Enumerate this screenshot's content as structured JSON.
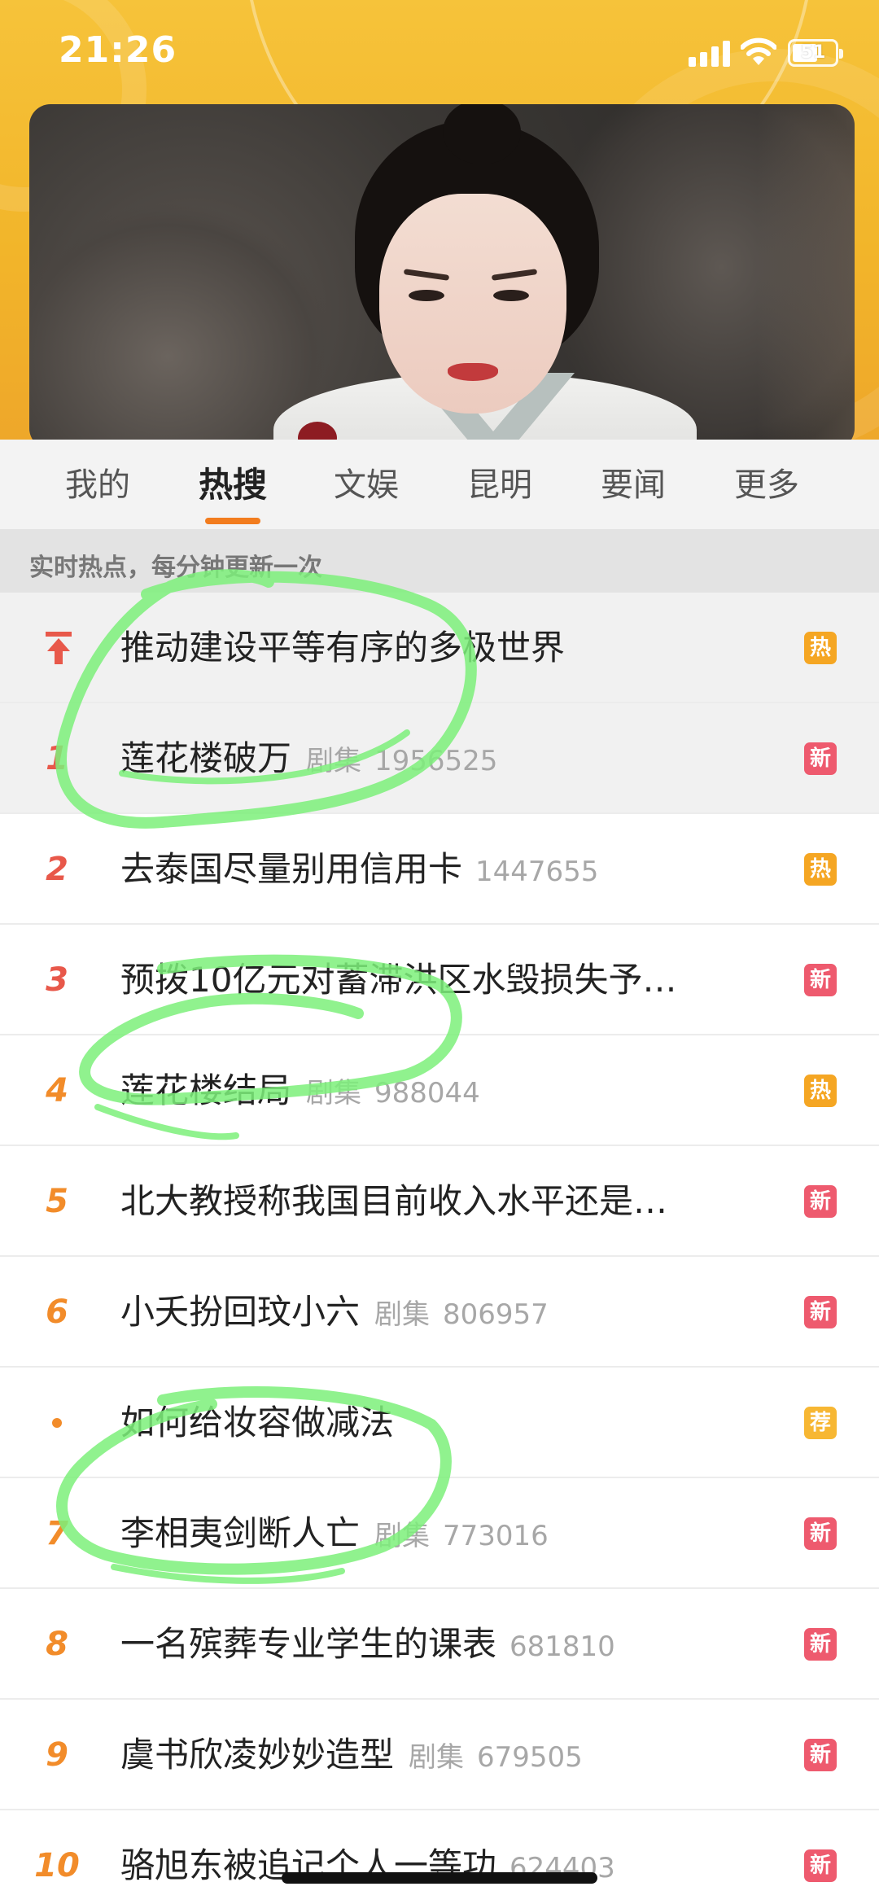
{
  "status_bar": {
    "time": "21:26",
    "battery": "51"
  },
  "tabs": [
    {
      "label": "我的"
    },
    {
      "label": "热搜"
    },
    {
      "label": "文娱"
    },
    {
      "label": "昆明"
    },
    {
      "label": "要闻"
    },
    {
      "label": "更多"
    }
  ],
  "active_tab": "热搜",
  "subtitle": "实时热点，每分钟更新一次",
  "colors": {
    "accent": "#f27c1e",
    "badge_hot": "#f5a623",
    "badge_new": "#ee5a6e",
    "badge_rec": "#f7b733",
    "marker": "#7cf07a"
  },
  "list": [
    {
      "rank": "",
      "rank_icon": "pin-top-icon",
      "title": "推动建设平等有序的多极世界",
      "category": "",
      "count": "",
      "badge": "热"
    },
    {
      "rank": "1",
      "title": "莲花楼破万",
      "category": "剧集",
      "count": "1956525",
      "badge": "新"
    },
    {
      "rank": "2",
      "title": "去泰国尽量别用信用卡",
      "category": "",
      "count": "1447655",
      "badge": "热"
    },
    {
      "rank": "3",
      "title": "预拨10亿元对蓄滞洪区水毁损失予…",
      "category": "",
      "count": "",
      "badge": "新"
    },
    {
      "rank": "4",
      "title": "莲花楼结局",
      "category": "剧集",
      "count": "988044",
      "badge": "热"
    },
    {
      "rank": "5",
      "title": "北大教授称我国目前收入水平还是…",
      "category": "",
      "count": "",
      "badge": "新"
    },
    {
      "rank": "6",
      "title": "小夭扮回玟小六",
      "category": "剧集",
      "count": "806957",
      "badge": "新"
    },
    {
      "rank": "•",
      "title": "如何给妆容做减法",
      "category": "",
      "count": "",
      "badge": "荐"
    },
    {
      "rank": "7",
      "title": "李相夷剑断人亡",
      "category": "剧集",
      "count": "773016",
      "badge": "新"
    },
    {
      "rank": "8",
      "title": "一名殡葬专业学生的课表",
      "category": "",
      "count": "681810",
      "badge": "新"
    },
    {
      "rank": "9",
      "title": "虞书欣凌妙妙造型",
      "category": "剧集",
      "count": "679505",
      "badge": "新"
    },
    {
      "rank": "10",
      "title": "骆旭东被追记个人一等功",
      "category": "",
      "count": "624403",
      "badge": "新"
    }
  ]
}
